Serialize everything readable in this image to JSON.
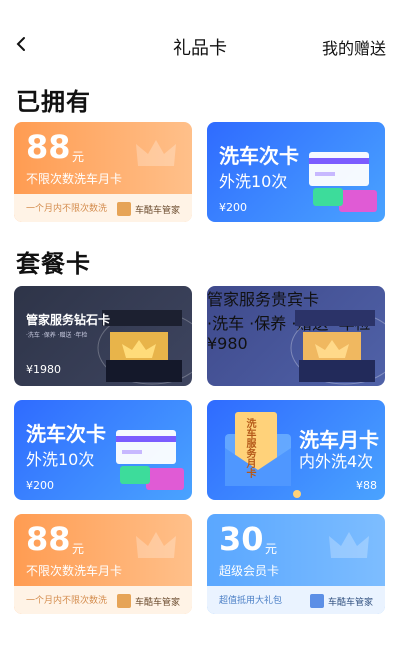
{
  "nav": {
    "title": "礼品卡",
    "right": "我的赠送"
  },
  "sections": {
    "owned": "已拥有",
    "packages": "套餐卡"
  },
  "cards": {
    "owned_1": {
      "amount": "88",
      "unit": "元",
      "desc": "不限次数洗车月卡",
      "sub": "一个月内不限次数洗",
      "brand": "车酷车管家"
    },
    "owned_2": {
      "title": "洗车次卡",
      "subtitle": "外洗10次",
      "price": "¥200"
    },
    "pkg_1": {
      "title": "管家服务钻石卡",
      "tags": "·洗车 ·保养 ·赠送 ·年检",
      "price": "¥1980"
    },
    "pkg_2": {
      "title": "管家服务贵宾卡",
      "tags": "·洗车 ·保养 ·赠送 ·年检",
      "price": "¥980"
    },
    "pkg_3": {
      "title": "洗车次卡",
      "subtitle": "外洗10次",
      "price": "¥200"
    },
    "pkg_4": {
      "title": "洗车月卡",
      "subtitle": "内外洗4次",
      "price": "¥88",
      "ticket_text": "洗车服务月卡"
    },
    "pkg_5": {
      "amount": "88",
      "unit": "元",
      "desc": "不限次数洗车月卡",
      "sub": "一个月内不限次数洗",
      "brand": "车酷车管家"
    },
    "pkg_6": {
      "amount": "30",
      "unit": "元",
      "desc": "超级会员卡",
      "sub": "超值抵用大礼包",
      "brand": "车酷车管家"
    }
  },
  "colors": {
    "orange": "#ff9c52",
    "blue": "#2f6bff",
    "dark": "#2e3448",
    "navy": "#3f4a8c",
    "lightblue": "#5aa7ff"
  }
}
